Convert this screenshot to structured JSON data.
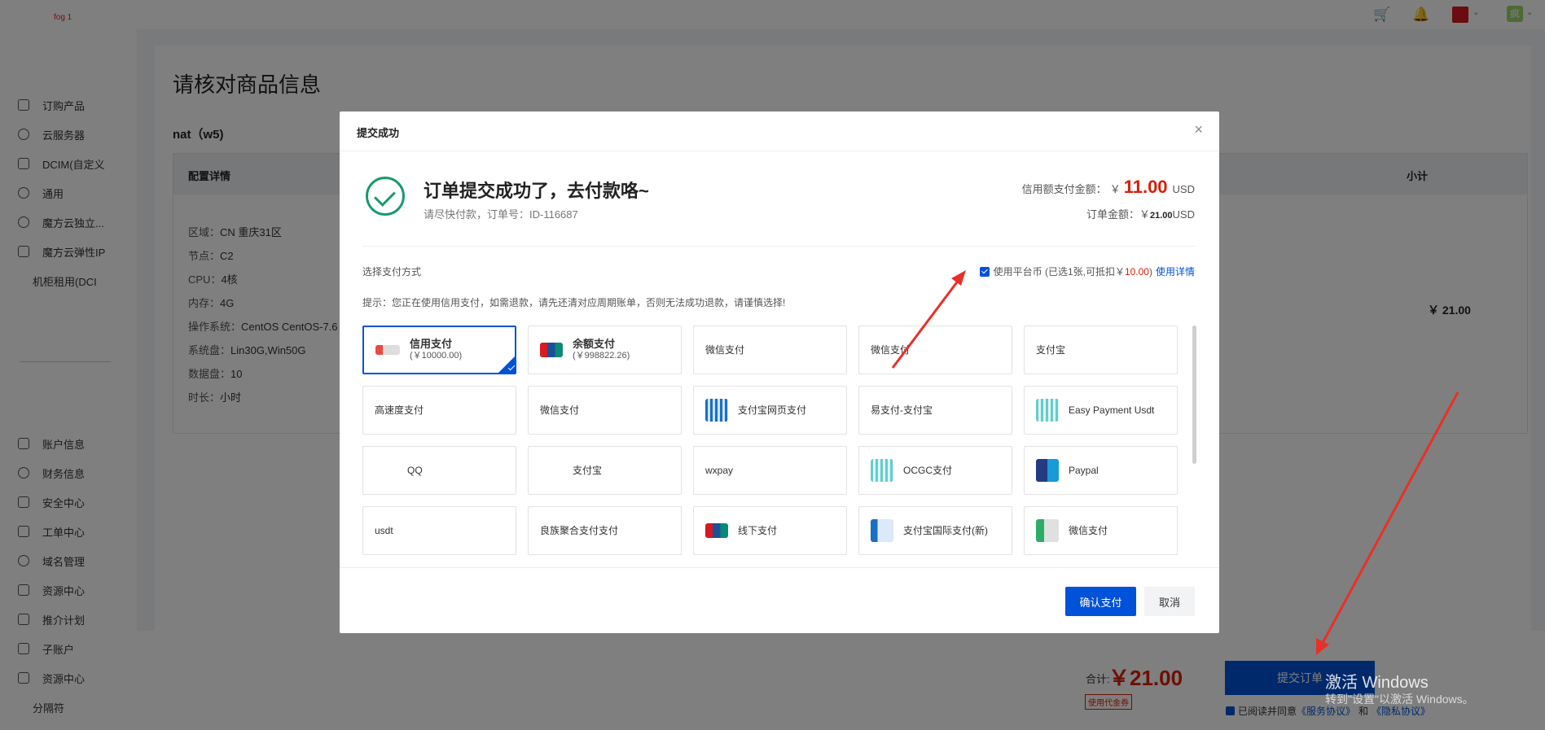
{
  "app": {
    "logo_text": "fog 1"
  },
  "sidebar": {
    "items": [
      {
        "label": "订购产品",
        "icon": "cart-icon"
      },
      {
        "label": "云服务器",
        "icon": "database-icon"
      },
      {
        "label": "DCIM(自定义",
        "icon": "server-icon"
      },
      {
        "label": "通用",
        "icon": "gear-icon"
      },
      {
        "label": "魔方云独立...",
        "icon": "registered-icon"
      },
      {
        "label": "魔方云弹性IP",
        "icon": "ip-icon"
      },
      {
        "label": "机柜租用(DCI",
        "icon": ""
      }
    ],
    "items2": [
      {
        "label": "账户信息",
        "icon": "user-card-icon"
      },
      {
        "label": "财务信息",
        "icon": "money-icon"
      },
      {
        "label": "安全中心",
        "icon": "lock-icon"
      },
      {
        "label": "工单中心",
        "icon": "ticket-icon"
      },
      {
        "label": "域名管理",
        "icon": "info-icon"
      },
      {
        "label": "资源中心",
        "icon": "resource-icon"
      },
      {
        "label": "推介计划",
        "icon": "grid-icon"
      },
      {
        "label": "子账户",
        "icon": "sub-account-icon"
      },
      {
        "label": "资源中心",
        "icon": "monitor-icon"
      },
      {
        "label": "分隔符",
        "icon": ""
      }
    ]
  },
  "topbar": {
    "cart_icon": "cart-icon",
    "bell_icon": "bell-icon",
    "avatar_text": "疯"
  },
  "page": {
    "title": "请核对商品信息",
    "product_name": "nat（w5)",
    "table_head_left": "配置详情",
    "table_head_right": "小计",
    "config": [
      {
        "key": "区域：",
        "value": "CN 重庆31区"
      },
      {
        "key": "节点：",
        "value": "C2"
      },
      {
        "key": "CPU：",
        "value": "4核"
      },
      {
        "key": "内存：",
        "value": "4G"
      },
      {
        "key": "操作系统：",
        "value": "CentOS CentOS-7.6"
      },
      {
        "key": "系统盘：",
        "value": "Lin30G,Win50G"
      },
      {
        "key": "数据盘：",
        "value": "10"
      },
      {
        "key": "时长：",
        "value": "小时"
      }
    ],
    "subtotal": "￥ 21.00"
  },
  "bottom": {
    "total_label": "合计:",
    "total_value": "￥21.00",
    "voucher_tag": "使用代金券",
    "submit_label": "提交订单",
    "agree_text": "已阅读并同意",
    "service_link": "《服务协议》",
    "and_text": "和",
    "privacy_link": "《隐私协议》"
  },
  "modal": {
    "title": "提交成功",
    "close": "×",
    "headline": "订单提交成功了，去付款咯~",
    "subline": "请尽快付款，订单号：ID-116687",
    "pay_label": "信用额支付金额：",
    "pay_currency": "￥",
    "pay_value": "11.00",
    "pay_unit": "USD",
    "order_label": "订单金额：",
    "order_currency": "￥",
    "order_value": "21.00",
    "order_unit": "USD",
    "choose_label": "选择支付方式",
    "platform_prefix": "使用平台币 (已选1张,可抵扣￥",
    "platform_amount": "10.00",
    "platform_suffix": ")",
    "platform_link": "使用详情",
    "tip": "提示：您正在使用信用支付，如需退款，请先还清对应周期账单，否则无法成功退款，请谨慎选择!",
    "methods": [
      {
        "label": "信用支付",
        "sub": "(￥10000.00)",
        "logo": "credit-pay-logo",
        "selected": true
      },
      {
        "label": "余额支付",
        "sub": "(￥998822.26)",
        "logo": "unionpay-logo",
        "selected": false
      },
      {
        "label": "微信支付",
        "sub": "",
        "logo": "",
        "selected": false
      },
      {
        "label": "微信支付",
        "sub": "",
        "logo": "",
        "selected": false
      },
      {
        "label": "支付宝",
        "sub": "",
        "logo": "",
        "selected": false
      },
      {
        "label": "高速度支付",
        "sub": "",
        "logo": "",
        "selected": false
      },
      {
        "label": "微信支付",
        "sub": "",
        "logo": "",
        "selected": false
      },
      {
        "label": "支付宝网页支付",
        "sub": "",
        "logo": "alipay-web-logo",
        "selected": false
      },
      {
        "label": "易支付-支付宝",
        "sub": "",
        "logo": "",
        "selected": false
      },
      {
        "label": "Easy Payment Usdt",
        "sub": "",
        "logo": "easy-payment-logo",
        "selected": false
      },
      {
        "label": "QQ",
        "sub": "",
        "logo": "blank-logo",
        "selected": false
      },
      {
        "label": "支付宝",
        "sub": "",
        "logo": "blank-logo",
        "selected": false
      },
      {
        "label": "wxpay",
        "sub": "",
        "logo": "",
        "selected": false
      },
      {
        "label": "OCGC支付",
        "sub": "",
        "logo": "ocgc-logo",
        "selected": false
      },
      {
        "label": "Paypal",
        "sub": "",
        "logo": "paypal-logo",
        "selected": false
      },
      {
        "label": "usdt",
        "sub": "",
        "logo": "",
        "selected": false
      },
      {
        "label": "良族聚合支付支付",
        "sub": "",
        "logo": "",
        "selected": false
      },
      {
        "label": "线下支付",
        "sub": "",
        "logo": "unionpay-logo",
        "selected": false
      },
      {
        "label": "支付宝国际支付(新)",
        "sub": "",
        "logo": "alipay-logo",
        "selected": false
      },
      {
        "label": "微信支付",
        "sub": "",
        "logo": "wechat-logo",
        "selected": false
      }
    ],
    "confirm_label": "确认支付",
    "cancel_label": "取消"
  },
  "watermark": {
    "line1": "激活 Windows",
    "line2": "转到\"设置\"以激活 Windows。"
  },
  "colors": {
    "primary": "#0052d9",
    "price_red": "#d81e06",
    "success_green": "#1a9a6a"
  }
}
